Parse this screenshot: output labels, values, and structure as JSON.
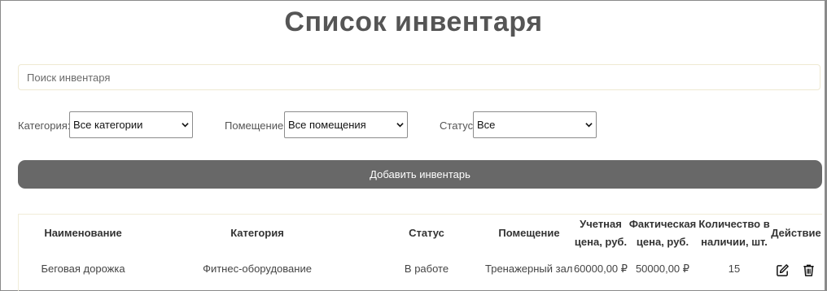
{
  "page": {
    "title": "Список инвентаря"
  },
  "search": {
    "placeholder": "Поиск инвентаря"
  },
  "filters": {
    "category": {
      "label": "Категория:",
      "value": "Все категории"
    },
    "room": {
      "label": "Помещение:",
      "value": "Все помещения"
    },
    "status": {
      "label": "Статус:",
      "value": "Все"
    }
  },
  "add_button": {
    "label": "Добавить инвентарь"
  },
  "table": {
    "headers": {
      "name": "Наименование",
      "category": "Категория",
      "status": "Статус",
      "room": "Помещение",
      "book_price_1": "Учетная",
      "book_price_2": "цена, руб.",
      "actual_price_1": "Фактическая",
      "actual_price_2": "цена, руб.",
      "qty_1": "Количество в",
      "qty_2": "наличии, шт.",
      "action": "Действие"
    },
    "rows": [
      {
        "name": "Беговая дорожка",
        "category": "Фитнес-оборудование",
        "status": "В работе",
        "room": "Тренажерный зал",
        "book_price": "60000,00 ₽",
        "actual_price": "50000,00 ₽",
        "qty": "15",
        "actions": [
          "edit-icon",
          "trash-icon"
        ]
      }
    ]
  }
}
